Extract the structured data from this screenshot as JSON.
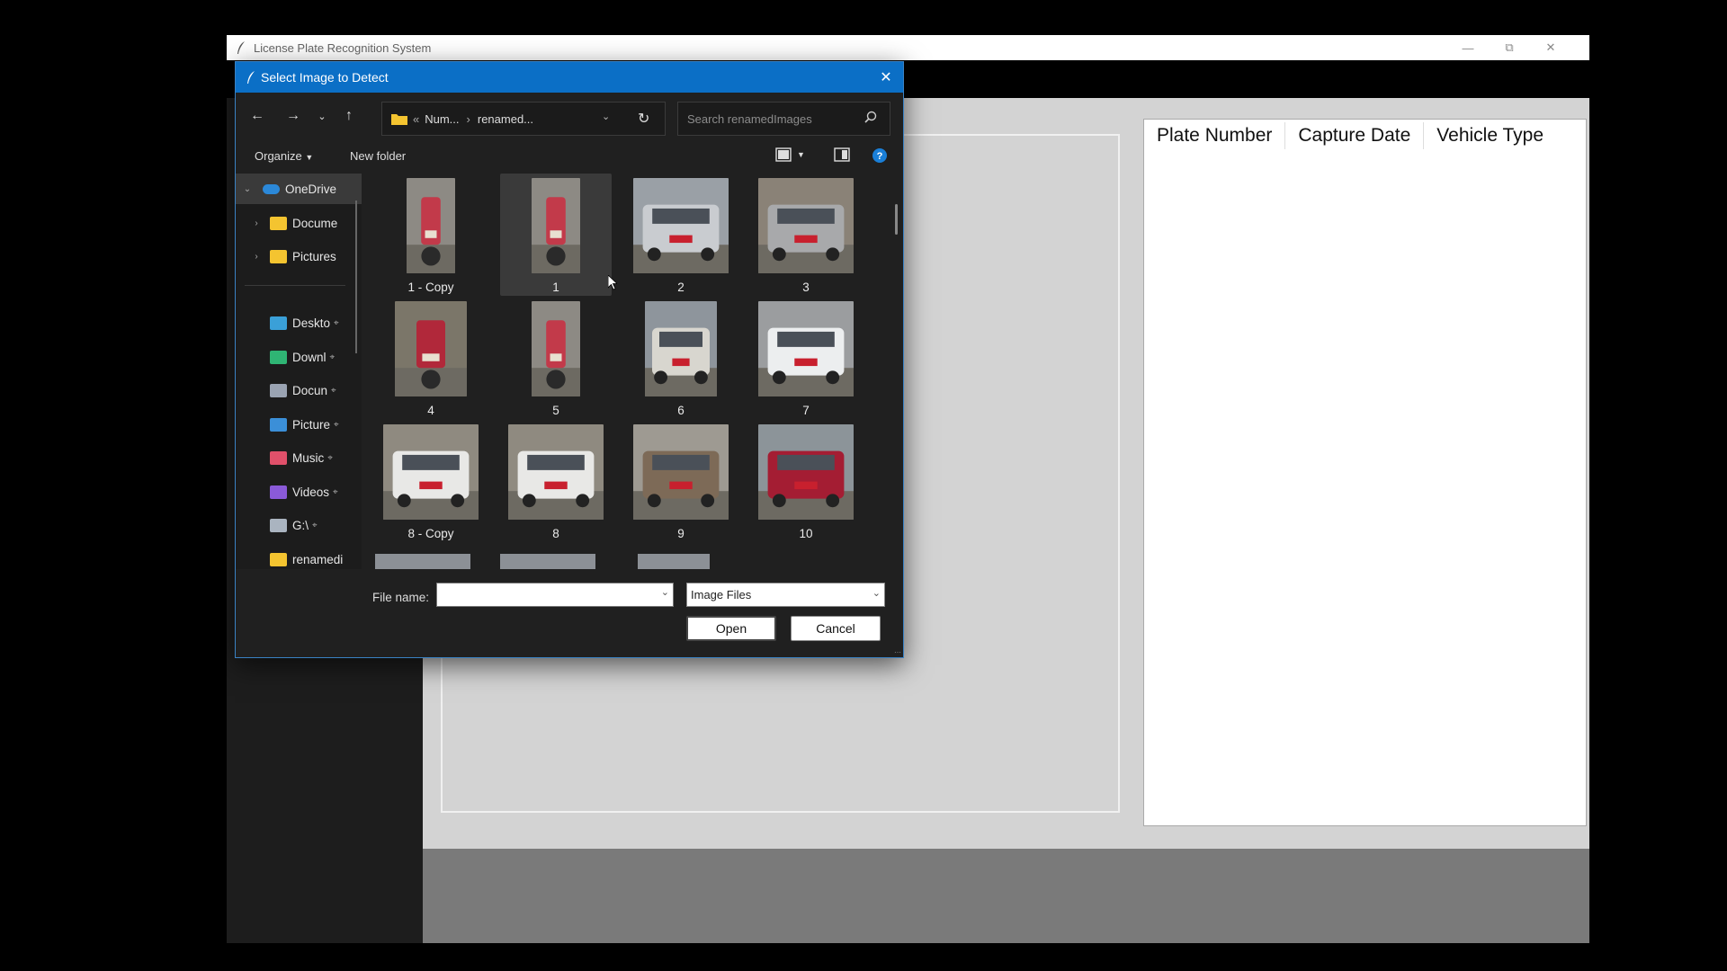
{
  "app": {
    "title": "License Plate Recognition System",
    "table": {
      "headers": [
        "Plate Number",
        "Capture Date",
        "Vehicle Type"
      ]
    }
  },
  "dialog": {
    "title": "Select Image to Detect",
    "address": {
      "prefix": "«",
      "crumb1": "Num...",
      "separator": "›",
      "crumb2": "renamed..."
    },
    "search_placeholder": "Search renamedImages",
    "toolbar": {
      "organize": "Organize",
      "new_folder": "New folder"
    },
    "tree": [
      {
        "label": "OneDrive",
        "icon": "cloud-icon",
        "color": "#2b88d8",
        "expanded": true
      },
      {
        "label": "Docume",
        "icon": "folder-icon",
        "color": "#f4c430"
      },
      {
        "label": "Pictures",
        "icon": "folder-icon",
        "color": "#f4c430"
      },
      {
        "label": "Deskto",
        "icon": "desktop-icon",
        "color": "#3aa0d8",
        "pinned": true
      },
      {
        "label": "Downl",
        "icon": "download-icon",
        "color": "#2fb574",
        "pinned": true
      },
      {
        "label": "Docun",
        "icon": "document-icon",
        "color": "#9aa3b2",
        "pinned": true
      },
      {
        "label": "Picture",
        "icon": "pictures-icon",
        "color": "#3b8fd8",
        "pinned": true
      },
      {
        "label": "Music",
        "icon": "music-icon",
        "color": "#e0506a",
        "pinned": true
      },
      {
        "label": "Videos",
        "icon": "videos-icon",
        "color": "#8a5ad8",
        "pinned": true
      },
      {
        "label": "G:\\",
        "icon": "drive-icon",
        "color": "#aab4c0",
        "pinned": true
      },
      {
        "label": "renamedi",
        "icon": "folder-icon",
        "color": "#f4c430"
      }
    ],
    "files": [
      {
        "name": "1 - Copy",
        "type": "motorbike"
      },
      {
        "name": "1",
        "type": "motorbike",
        "selected": true
      },
      {
        "name": "2",
        "type": "car-silver"
      },
      {
        "name": "3",
        "type": "car-grey"
      },
      {
        "name": "4",
        "type": "motorbike-red"
      },
      {
        "name": "5",
        "type": "motorbike"
      },
      {
        "name": "6",
        "type": "bus"
      },
      {
        "name": "7",
        "type": "van-white"
      },
      {
        "name": "8 - Copy",
        "type": "van-white-rear"
      },
      {
        "name": "8",
        "type": "van-white-rear"
      },
      {
        "name": "9",
        "type": "jeep"
      },
      {
        "name": "10",
        "type": "car-red"
      }
    ],
    "file_name_label": "File name:",
    "file_name_value": "",
    "filter": "Image Files",
    "open_label": "Open",
    "cancel_label": "Cancel"
  },
  "colors": {
    "dialog_title_bg": "#0b6fc6",
    "dialog_bg": "#202020",
    "app_content_bg": "#d3d3d3"
  }
}
